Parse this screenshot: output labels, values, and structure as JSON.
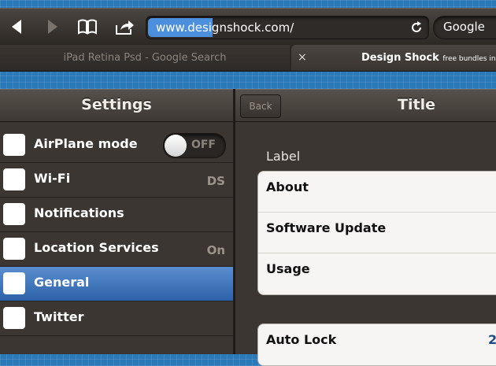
{
  "browser": {
    "url": "www.designshock.com/",
    "search_engine": "Google",
    "tabs": [
      {
        "label": "iPad Retina Psd - Google Search"
      },
      {
        "label": "Design Shock",
        "sublabel": "free bundles in your n",
        "close": "×"
      }
    ]
  },
  "settings": {
    "title": "Settings",
    "items": [
      {
        "label": "AirPlane mode",
        "value": "",
        "toggle_text": "OFF"
      },
      {
        "label": "Wi-Fi",
        "value": "DS"
      },
      {
        "label": "Notifications",
        "value": ""
      },
      {
        "label": "Location Services",
        "value": "On"
      },
      {
        "label": "General",
        "value": "",
        "selected": true
      },
      {
        "label": "Twitter",
        "value": ""
      }
    ]
  },
  "detail": {
    "back_label": "Back",
    "title": "Title",
    "group_label": "Label",
    "group1": [
      {
        "label": "About"
      },
      {
        "label": "Software Update"
      },
      {
        "label": "Usage"
      }
    ],
    "group2": [
      {
        "label": "Auto Lock",
        "value": "2"
      }
    ]
  },
  "colors": {
    "background": "#2a79b8",
    "selected_row": "#3f75bd",
    "url_highlight": "#4c8fdc"
  }
}
